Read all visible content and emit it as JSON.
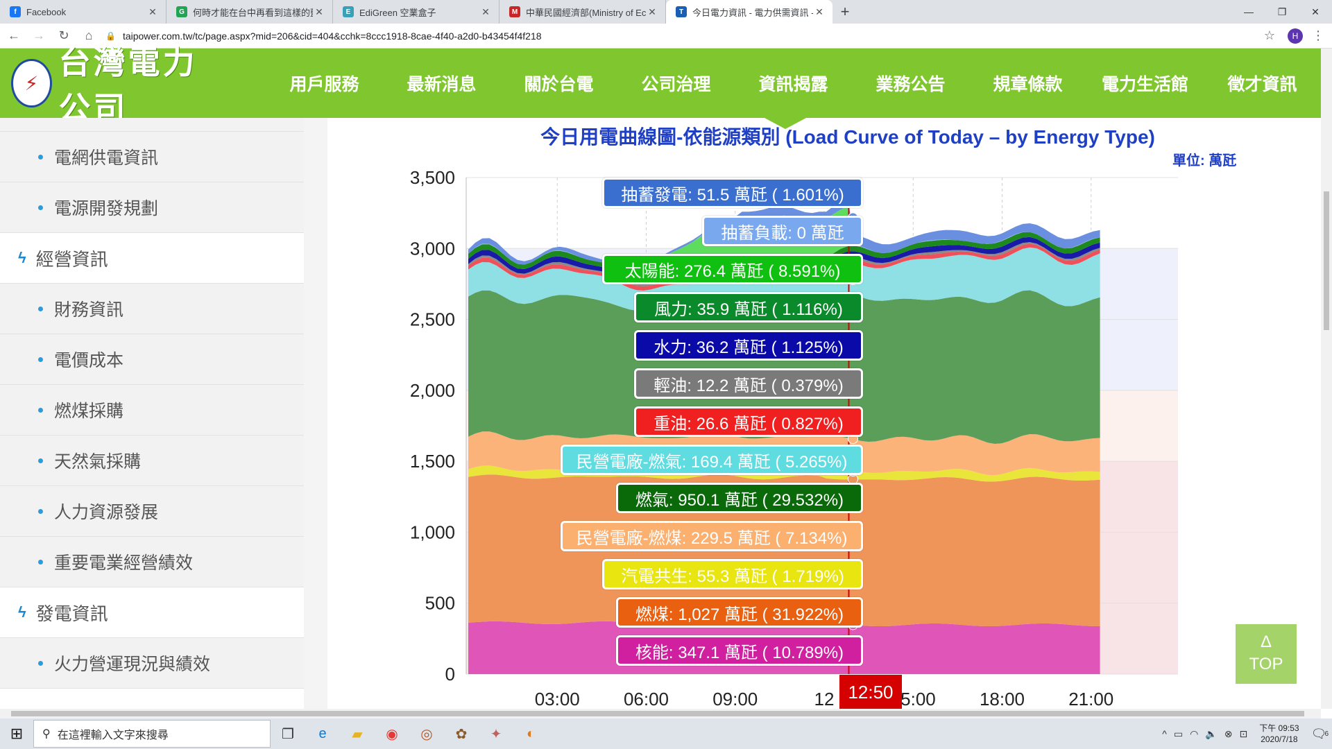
{
  "browser": {
    "tabs": [
      {
        "title": "Facebook",
        "favicon_color": "#1877f2",
        "favicon_glyph": "f"
      },
      {
        "title": "何時才能在台中再看到這樣的藍天",
        "favicon_color": "#23a455",
        "favicon_glyph": "G"
      },
      {
        "title": "EdiGreen 空業盒子",
        "favicon_color": "#3aa0b8",
        "favicon_glyph": "E"
      },
      {
        "title": "中華民國經濟部(Ministry of Econ",
        "favicon_color": "#c62828",
        "favicon_glyph": "M"
      },
      {
        "title": "今日電力資訊 - 電力供需資訊 - 台",
        "favicon_color": "#1a5fb4",
        "favicon_glyph": "T"
      }
    ],
    "url": "taipower.com.tw/tc/page.aspx?mid=206&cid=404&cchk=8ccc1918-8cae-4f40-a2d0-b43454f4f218",
    "profile_initial": "H"
  },
  "site": {
    "logo_text": "台灣電力公司",
    "nav": [
      "用戶服務",
      "最新消息",
      "關於台電",
      "公司治理",
      "資訊揭露",
      "業務公告",
      "規章條款",
      "電力生活館",
      "徵才資訊"
    ]
  },
  "sidebar": {
    "items": [
      {
        "type": "sub",
        "label": "電網供電資訊"
      },
      {
        "type": "sub",
        "label": "電源開發規劃"
      },
      {
        "type": "head",
        "label": "經營資訊"
      },
      {
        "type": "sub",
        "label": "財務資訊"
      },
      {
        "type": "sub",
        "label": "電價成本"
      },
      {
        "type": "sub",
        "label": "燃煤採購"
      },
      {
        "type": "sub",
        "label": "天然氣採購"
      },
      {
        "type": "sub",
        "label": "人力資源發展"
      },
      {
        "type": "sub",
        "label": "重要電業經營績效"
      },
      {
        "type": "head",
        "label": "發電資訊"
      },
      {
        "type": "sub",
        "label": "火力營運現況與績效"
      }
    ]
  },
  "chart_data": {
    "type": "area",
    "title": "今日用電曲線圖-依能源類別 (Load Curve of Today – by Energy Type)",
    "unit_label": "單位: 萬瓩",
    "y_ticks": [
      "0",
      "500",
      "1,000",
      "1,500",
      "2,000",
      "2,500",
      "3,000",
      "3,500"
    ],
    "ylim": [
      0,
      3500
    ],
    "x_ticks": [
      "03:00",
      "06:00",
      "09:00",
      "12",
      "15:00",
      "18:00",
      "21:00"
    ],
    "cursor_time": "12:50",
    "stacked": true,
    "series": [
      {
        "name": "核能",
        "color": "#e055b8",
        "current": 347.1,
        "tooltip": "核能: 347.1 萬瓩 ( 10.789%)"
      },
      {
        "name": "燃煤",
        "color": "#f0955a",
        "current": 1027,
        "tooltip": "燃煤: 1,027 萬瓩 ( 31.922%)"
      },
      {
        "name": "汽電共生",
        "color": "#e9e53a",
        "current": 55.3,
        "tooltip": "汽電共生: 55.3 萬瓩 ( 1.719%)"
      },
      {
        "name": "民營電廠-燃煤",
        "color": "#fbb37a",
        "current": 229.5,
        "tooltip": "民營電廠-燃煤: 229.5 萬瓩 ( 7.134%)"
      },
      {
        "name": "燃氣",
        "color": "#5a9e5a",
        "current": 950.1,
        "tooltip": "燃氣: 950.1 萬瓩 ( 29.532%)"
      },
      {
        "name": "民營電廠-燃氣",
        "color": "#8ee0e4",
        "current": 169.4,
        "tooltip": "民營電廠-燃氣: 169.4 萬瓩 ( 5.265%)"
      },
      {
        "name": "重油",
        "color": "#f0505a",
        "current": 26.6,
        "tooltip": "重油: 26.6 萬瓩 ( 0.827%)"
      },
      {
        "name": "輕油",
        "color": "#8a8a8a",
        "current": 12.2,
        "tooltip": "輕油: 12.2 萬瓩 ( 0.379%)"
      },
      {
        "name": "水力",
        "color": "#1a1aa8",
        "current": 36.2,
        "tooltip": "水力: 36.2 萬瓩 ( 1.125%)"
      },
      {
        "name": "風力",
        "color": "#1e8a1e",
        "current": 35.9,
        "tooltip": "風力: 35.9 萬瓩 ( 1.116%)"
      },
      {
        "name": "太陽能",
        "color": "#5edc5e",
        "current": 276.4,
        "tooltip": "太陽能: 276.4 萬瓩 ( 8.591%)"
      },
      {
        "name": "抽蓄負載",
        "color": "#8ab4f0",
        "current": 0,
        "tooltip": "抽蓄負載: 0 萬瓩"
      },
      {
        "name": "抽蓄發電",
        "color": "#6a8fe0",
        "current": 51.5,
        "tooltip": "抽蓄發電: 51.5 萬瓩 ( 1.601%)"
      }
    ],
    "tooltip_colors": [
      "#3a6fd0",
      "#7aa8ee",
      "#10c010",
      "#0a8a2a",
      "#0a0aa8",
      "#7a7a7a",
      "#f02020",
      "#5edce0",
      "#0a6a0a",
      "#fbb070",
      "#e9e510",
      "#e86010",
      "#d020a0"
    ]
  },
  "top_button": {
    "arrow": "Δ",
    "label": "TOP"
  },
  "taskbar": {
    "search_placeholder": "在這裡輸入文字來搜尋",
    "clock_time": "下午 09:53",
    "clock_date": "2020/7/18",
    "notification_count": "6"
  }
}
